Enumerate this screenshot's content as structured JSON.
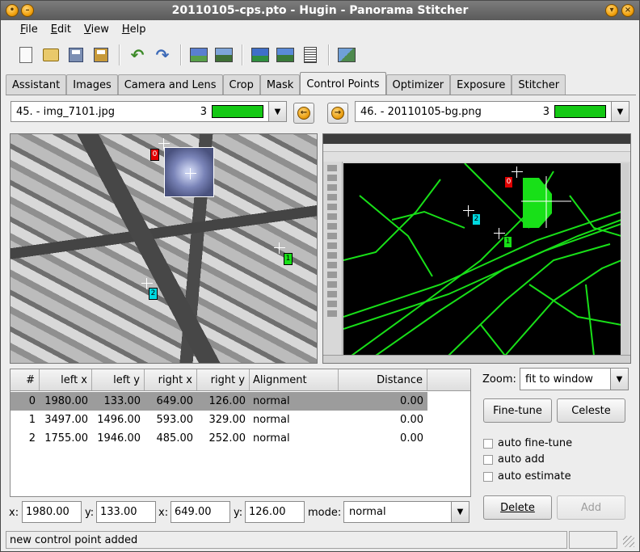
{
  "window": {
    "title": "20110105-cps.pto - Hugin - Panorama Stitcher"
  },
  "menu": [
    {
      "label": "File",
      "key": "F",
      "rest": "ile"
    },
    {
      "label": "Edit",
      "key": "E",
      "rest": "dit"
    },
    {
      "label": "View",
      "key": "V",
      "rest": "iew"
    },
    {
      "label": "Help",
      "key": "H",
      "rest": "elp"
    }
  ],
  "tabs": [
    "Assistant",
    "Images",
    "Camera and Lens",
    "Crop",
    "Mask",
    "Control Points",
    "Optimizer",
    "Exposure",
    "Stitcher"
  ],
  "active_tab": "Control Points",
  "left_image": {
    "name": "45. - img_7101.jpg",
    "count": "3"
  },
  "right_image": {
    "name": "46. - 20110105-bg.png",
    "count": "3"
  },
  "point_labels": {
    "p0": "0",
    "p1": "1",
    "p2": "2"
  },
  "table": {
    "headers": [
      "#",
      "left x",
      "left y",
      "right x",
      "right y",
      "Alignment",
      "Distance"
    ],
    "rows": [
      {
        "n": "0",
        "lx": "1980.00",
        "ly": "133.00",
        "rx": "649.00",
        "ry": "126.00",
        "align": "normal",
        "dist": "0.00"
      },
      {
        "n": "1",
        "lx": "3497.00",
        "ly": "1496.00",
        "rx": "593.00",
        "ry": "329.00",
        "align": "normal",
        "dist": "0.00"
      },
      {
        "n": "2",
        "lx": "1755.00",
        "ly": "1946.00",
        "rx": "485.00",
        "ry": "252.00",
        "align": "normal",
        "dist": "0.00"
      }
    ]
  },
  "edit": {
    "x_label": "x:",
    "y_label": "y:",
    "x2_label": "x:",
    "y2_label": "y:",
    "mode_label": "mode:",
    "left_x": "1980.00",
    "left_y": "133.00",
    "right_x": "649.00",
    "right_y": "126.00",
    "mode": "normal"
  },
  "zoom": {
    "label": "Zoom:",
    "value": "fit to window"
  },
  "buttons": {
    "fine_tune": "Fine-tune",
    "celeste": "Celeste",
    "delete": "Delete",
    "add": "Add"
  },
  "checks": {
    "auto_fine_tune": "auto fine-tune",
    "auto_add": "auto add",
    "auto_estimate": "auto estimate"
  },
  "status": "new control point added",
  "colors": {
    "match_bar": "#14c814",
    "point_red": "#e00000",
    "point_cyan": "#00d8e0",
    "point_green": "#18e018"
  }
}
